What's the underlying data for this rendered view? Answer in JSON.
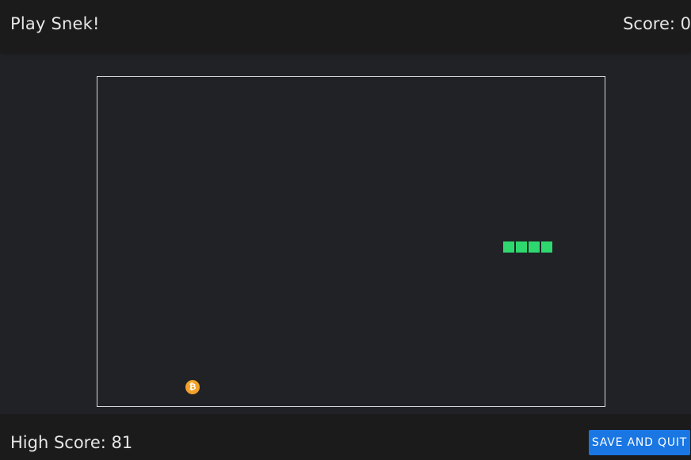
{
  "header": {
    "title": "Play Snek!",
    "score_text": "Score: 0"
  },
  "board": {
    "snake_color": "#2fd86f",
    "food": {
      "icon": "bitcoin-icon",
      "symbol": "₿",
      "color": "#f2a22a"
    }
  },
  "footer": {
    "high_score_text": "High Score: 81",
    "save_button_label": "SAVE AND QUIT",
    "button_color": "#1976e3"
  }
}
